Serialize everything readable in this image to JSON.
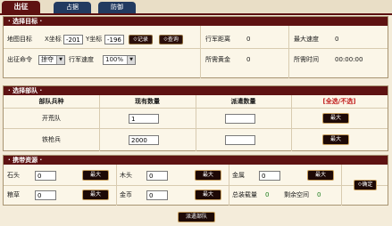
{
  "tabs": [
    "出征",
    "占据",
    "防御"
  ],
  "target": {
    "title": "选择目标",
    "map_target_label": "地图目标",
    "x_label": "X坐标",
    "x_value": "-201",
    "y_label": "Y坐标",
    "y_value": "-196",
    "record_btn": "记录",
    "query_btn": "查询",
    "distance_label": "行军距离",
    "distance_value": "0",
    "max_speed_label": "最大速度",
    "max_speed_value": "0",
    "order_label": "出征命令",
    "order_value": "掠夺",
    "speed_label": "行军速度",
    "speed_value": "100%",
    "gold_label": "所需黄金",
    "gold_value": "0",
    "time_label": "所需时间",
    "time_value": "00:00:00"
  },
  "troops": {
    "title": "选择部队",
    "col_type": "部队兵种",
    "col_current": "现有数量",
    "col_send": "派遣数量",
    "select_all": "[全选/不选]",
    "rows": [
      {
        "name": "开荒队",
        "current": "1",
        "send": "",
        "max": "最大"
      },
      {
        "name": "铁枪兵",
        "current": "2000",
        "send": "",
        "max": "最大"
      }
    ]
  },
  "resources": {
    "title": "携带资源",
    "stone_label": "石头",
    "stone_value": "0",
    "wood_label": "木头",
    "wood_value": "0",
    "metal_label": "金属",
    "metal_value": "0",
    "food_label": "粮草",
    "food_value": "0",
    "coin_label": "金币",
    "coin_value": "0",
    "max_label": "最大",
    "total_label": "总装载量",
    "total_value": "0",
    "space_label": "剩余空间",
    "space_value": "0",
    "confirm_btn": "确定"
  },
  "dispatch_btn": "派遣部队"
}
